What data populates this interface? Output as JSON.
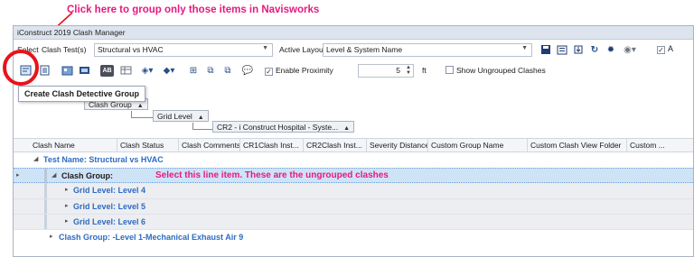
{
  "annotations": {
    "top_callout": "Click here to group only those items in Navisworks",
    "row_callout": "Select this line item. These are the ungrouped clashes",
    "callout_color": "#e6197e"
  },
  "window": {
    "title": "iConstruct 2019 Clash Manager"
  },
  "toolbar1": {
    "select_label": "Clash Test(s)",
    "select_prefix": "Select",
    "clash_test_value": "Structural vs HVAC",
    "active_layout_label": "Active Layout",
    "active_layout_value": "Level & System Name"
  },
  "toolbar2": {
    "enable_proximity_label": "Enable Proximity",
    "enable_proximity_checked": true,
    "proximity_value": "5",
    "proximity_unit": "ft",
    "show_ungrouped_label": "Show Ungrouped Clashes",
    "show_ungrouped_checked": false
  },
  "tooltip": {
    "text": "Create Clash Detective Group"
  },
  "group_panel": {
    "chips": [
      "Clash Group",
      "Grid Level",
      "CR2 - i Construct Hospital - Syste..."
    ]
  },
  "grid": {
    "columns": [
      "Clash Name",
      "Clash Status",
      "Clash Comments",
      "CR1Clash Inst...",
      "CR2Clash Inst...",
      "Severity Distance",
      "Custom Group Name",
      "Custom Clash View Folder",
      "Custom ..."
    ],
    "rows": [
      {
        "label": "Test Name: Structural vs HVAC"
      },
      {
        "label": "Clash Group:"
      },
      {
        "label": "Grid Level: Level 4"
      },
      {
        "label": "Grid Level: Level 5"
      },
      {
        "label": "Grid Level: Level 6"
      },
      {
        "label": "Clash Group: -Level 1-Mechanical Exhaust Air 9"
      }
    ]
  },
  "colors": {
    "accent_red": "#e8131b",
    "group_blue": "#2e6bc3",
    "selected_row": "#cfe3f7"
  }
}
